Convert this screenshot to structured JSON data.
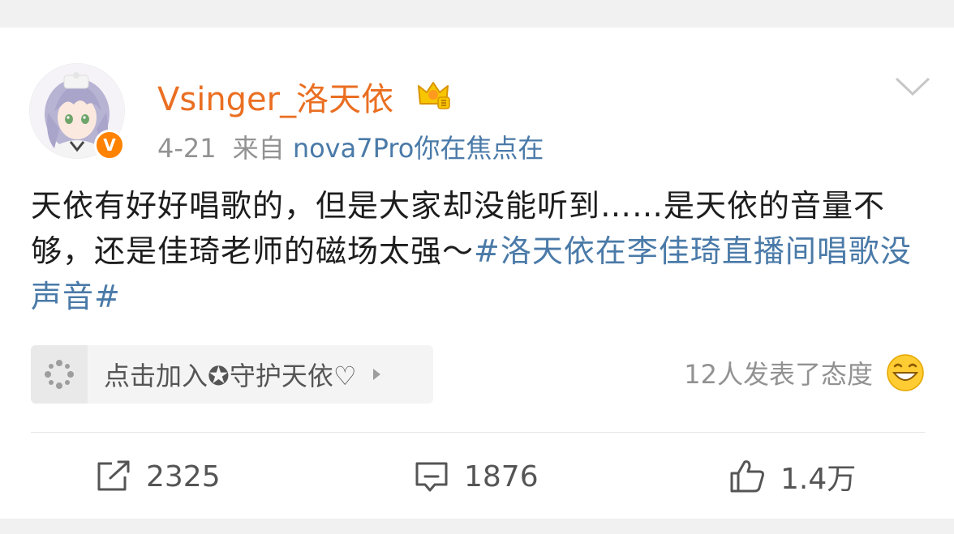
{
  "post": {
    "author": "Vsinger_洛天依",
    "date": "4-21",
    "source_prefix": "来自",
    "source_app": "nova7Pro你在焦点在",
    "text": "天依有好好唱歌的，但是大家却没能听到……是天依的音量不够，还是佳琦老师的磁场太强～",
    "hashtag": "#洛天依在李佳琦直播间唱歌没声音#"
  },
  "guard": {
    "label": "点击加入✪守护天依♡"
  },
  "reactions": {
    "text": "12人发表了态度",
    "emoji": "grinning-emoji"
  },
  "actions": {
    "repost_count": "2325",
    "comment_count": "1876",
    "like_count": "1.4万"
  },
  "icons": {
    "verified": "verified-v-badge",
    "crown": "crown-icon",
    "more": "chevron-down-icon",
    "repost": "repost-icon",
    "comment": "comment-icon",
    "like": "thumbs-up-icon",
    "guard": "sparkle-icon"
  },
  "colors": {
    "author": "#ea6f22",
    "link": "#4a7aa8",
    "meta": "#929292",
    "verified": "#ff8200"
  },
  "badges": {
    "verified_letter": "V"
  }
}
